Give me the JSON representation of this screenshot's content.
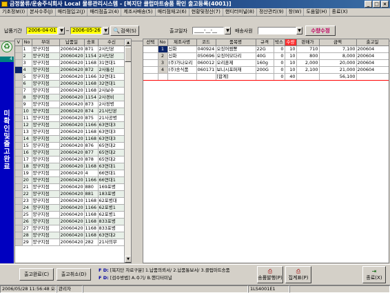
{
  "window": {
    "title": "금정물류/운송주식회사 Local 물류관리시스템 - [복지단 클럽마트송품 확인 출고등록(4001)]",
    "controls": [
      "_",
      "□",
      "×"
    ]
  },
  "menu": [
    "기초정보(I)",
    "본사수주(J)",
    "매리점입고(J)",
    "매리점출고(4)",
    "제조사배송(5)",
    "매리점재고(6)",
    "현황및정산(7)",
    "핸디터미널(8)",
    "정산관리(9)",
    "창(W)",
    "도움말(H)",
    "종료(X)"
  ],
  "toolbar": {
    "period_label": "납품기간",
    "date_from": "2006-04-01",
    "date_to": "2006-05-26",
    "search_label": "검색(S)",
    "ship_date_label": "출고일자",
    "ship_date_value": "____-__-__",
    "delivery_staff_label": "배송사원",
    "delivery_staff_value": "",
    "qty_edit_label": "수량수정"
  },
  "left": {
    "row_indicator": "4",
    "vertical_title": "미확인 및 출고완료",
    "columns": [
      "V",
      "No",
      "부대",
      "납품일",
      "송표",
      "수신"
    ],
    "rows": [
      [
        "",
        "1",
        "양구지점",
        "20060420",
        "871",
        "2사단본"
      ],
      [
        "",
        "2",
        "양구지점",
        "20060420",
        "1154",
        "2사단본"
      ],
      [
        "",
        "3",
        "양구지점",
        "20060420",
        "1168",
        "31연대1"
      ],
      [
        "",
        "4",
        "양구지점",
        "20060420",
        "872",
        "2사통신"
      ],
      [
        "",
        "5",
        "양구지점",
        "20060420",
        "1166",
        "32연대1"
      ],
      [
        "",
        "6",
        "양구지점",
        "20060420",
        "1168",
        "32연대1"
      ],
      [
        "",
        "7",
        "양구지점",
        "20060420",
        "1168",
        "2사보수"
      ],
      [
        "",
        "8",
        "양구지점",
        "20060420",
        "1154",
        "2사경비"
      ],
      [
        "",
        "9",
        "양구지점",
        "20060420",
        "873",
        "2사정병"
      ],
      [
        "",
        "10",
        "양구지점",
        "20060420",
        "874",
        "21사단본"
      ],
      [
        "",
        "11",
        "양구지점",
        "20060420",
        "875",
        "21사공병"
      ],
      [
        "",
        "12",
        "양구지점",
        "20060420",
        "1166",
        "63연대3"
      ],
      [
        "",
        "13",
        "양구지점",
        "20060420",
        "1168",
        "63연대3"
      ],
      [
        "",
        "14",
        "양구지점",
        "20060420",
        "1168",
        "63연대3"
      ],
      [
        "",
        "15",
        "양구지점",
        "20060420",
        "876",
        "65연대2"
      ],
      [
        "",
        "16",
        "양구지점",
        "20060420",
        "877",
        "65연대2"
      ],
      [
        "",
        "17",
        "양구지점",
        "20060420",
        "878",
        "65연대2"
      ],
      [
        "",
        "18",
        "양구지점",
        "20060420",
        "1168",
        "63연대1"
      ],
      [
        "",
        "19",
        "양구지점",
        "20060420",
        "4",
        "66연대1"
      ],
      [
        "",
        "20",
        "양구지점",
        "20060420",
        "1166",
        "66연대1"
      ],
      [
        "",
        "21",
        "양구지점",
        "20060420",
        "880",
        "169포병"
      ],
      [
        "",
        "22",
        "양구지점",
        "20060420",
        "881",
        "183포병"
      ],
      [
        "",
        "23",
        "양구지점",
        "20060420",
        "1168",
        "62포병대"
      ],
      [
        "",
        "24",
        "양구지점",
        "20060420",
        "1166",
        "62포병1"
      ],
      [
        "",
        "25",
        "양구지점",
        "20060420",
        "1168",
        "62포병1"
      ],
      [
        "",
        "26",
        "양구지점",
        "20060420",
        "1168",
        "833포병"
      ],
      [
        "",
        "27",
        "양구지점",
        "20060420",
        "1168",
        "833포병"
      ],
      [
        "",
        "28",
        "양구지점",
        "20060420",
        "1168",
        "63연대2"
      ],
      [
        "",
        "29",
        "양구지점",
        "20060420",
        "282",
        "21사의무"
      ]
    ]
  },
  "right": {
    "columns": [
      "선택",
      "No",
      "제조사명",
      "코드",
      "품목명",
      "규격",
      "박스",
      "수량",
      "판매가",
      "금액",
      "출고일"
    ],
    "rows": [
      [
        "",
        "1",
        "신화",
        "040924",
        "오징어짬뽕",
        "22G",
        "0",
        "10",
        "710",
        "7,100",
        "200604"
      ],
      [
        "",
        "2",
        "신화",
        "050696",
        "오징어모다리",
        "40G",
        "0",
        "10",
        "800",
        "8,000",
        "200604"
      ],
      [
        "",
        "3",
        "(주)가나오리",
        "060012",
        "오리훈제",
        "160g",
        "0",
        "10",
        "2,000",
        "20,000",
        "200604"
      ],
      [
        "",
        "4",
        "(주)송식품",
        "060171",
        "보니시포퍼재",
        "200G",
        "0",
        "10",
        "2,100",
        "21,000",
        "200604"
      ]
    ],
    "total_label": "[합계]",
    "total_boxes": "0",
    "total_qty": "40",
    "total_amount": "56,100"
  },
  "bottom": {
    "ship_done": "출고완료(C)",
    "ship_cancel": "출고취소(D)",
    "hint1_key": "F D:",
    "hint1": "[복지단 자료구분] 1.납품의뢰서/ 2.납품통보서/ 3.클럽마트송품",
    "hint2_key": "F D:",
    "hint2": "[검수방법] A.수기/ B.핸디터미널",
    "print_slip": "송품발행(P)",
    "aggregate": "집계표(P)",
    "exit": "종료(X)"
  },
  "status": {
    "time": "2006/05/28 11:56:48 오후",
    "user": "관리자",
    "form": "1LS4001E1"
  },
  "colors": {
    "title": "#0a246a",
    "accent_red": "#ff3030",
    "vertical_panel": "#0000c0"
  }
}
